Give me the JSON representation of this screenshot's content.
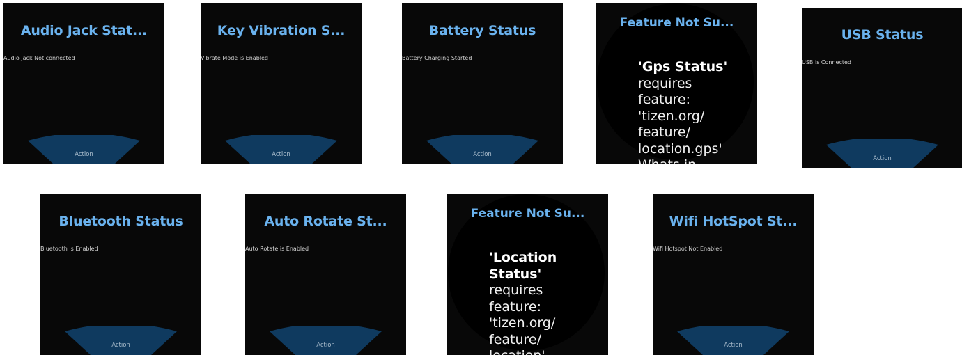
{
  "panels": [
    {
      "title": "Audio Jack Stat...",
      "message": "Audio Jack Not connected",
      "action": "Action"
    },
    {
      "title": "Key Vibration S...",
      "message": "Vibrate Mode is Enabled",
      "action": "Action"
    },
    {
      "title": "Battery Status",
      "message": "Battery Charging Started",
      "action": "Action"
    },
    {
      "title": "Feature Not Su...",
      "feature": "'Gps Status'",
      "lines": [
        "requires",
        "feature:",
        "'tizen.org/",
        "feature/",
        "location.gps'",
        "Whats in..."
      ]
    },
    {
      "title": "USB Status",
      "message": "USB is Connected",
      "action": "Action"
    },
    {
      "title": "Bluetooth Status",
      "message": "Bluetooth is Enabled",
      "action": "Action"
    },
    {
      "title": "Auto Rotate St...",
      "message": "Auto Rotate is Enabled",
      "action": "Action"
    },
    {
      "title": "Feature Not Su...",
      "feature_lines": [
        "'Location",
        "Status'"
      ],
      "lines": [
        "requires",
        "feature:",
        "'tizen.org/",
        "feature/",
        "location'"
      ]
    },
    {
      "title": "Wifi HotSpot St...",
      "message": "Wifi Hotspot Not Enabled",
      "action": "Action"
    }
  ],
  "colors": {
    "title": "#6ab2ee",
    "action_shape": "#0f3a5f",
    "background": "#080808"
  }
}
